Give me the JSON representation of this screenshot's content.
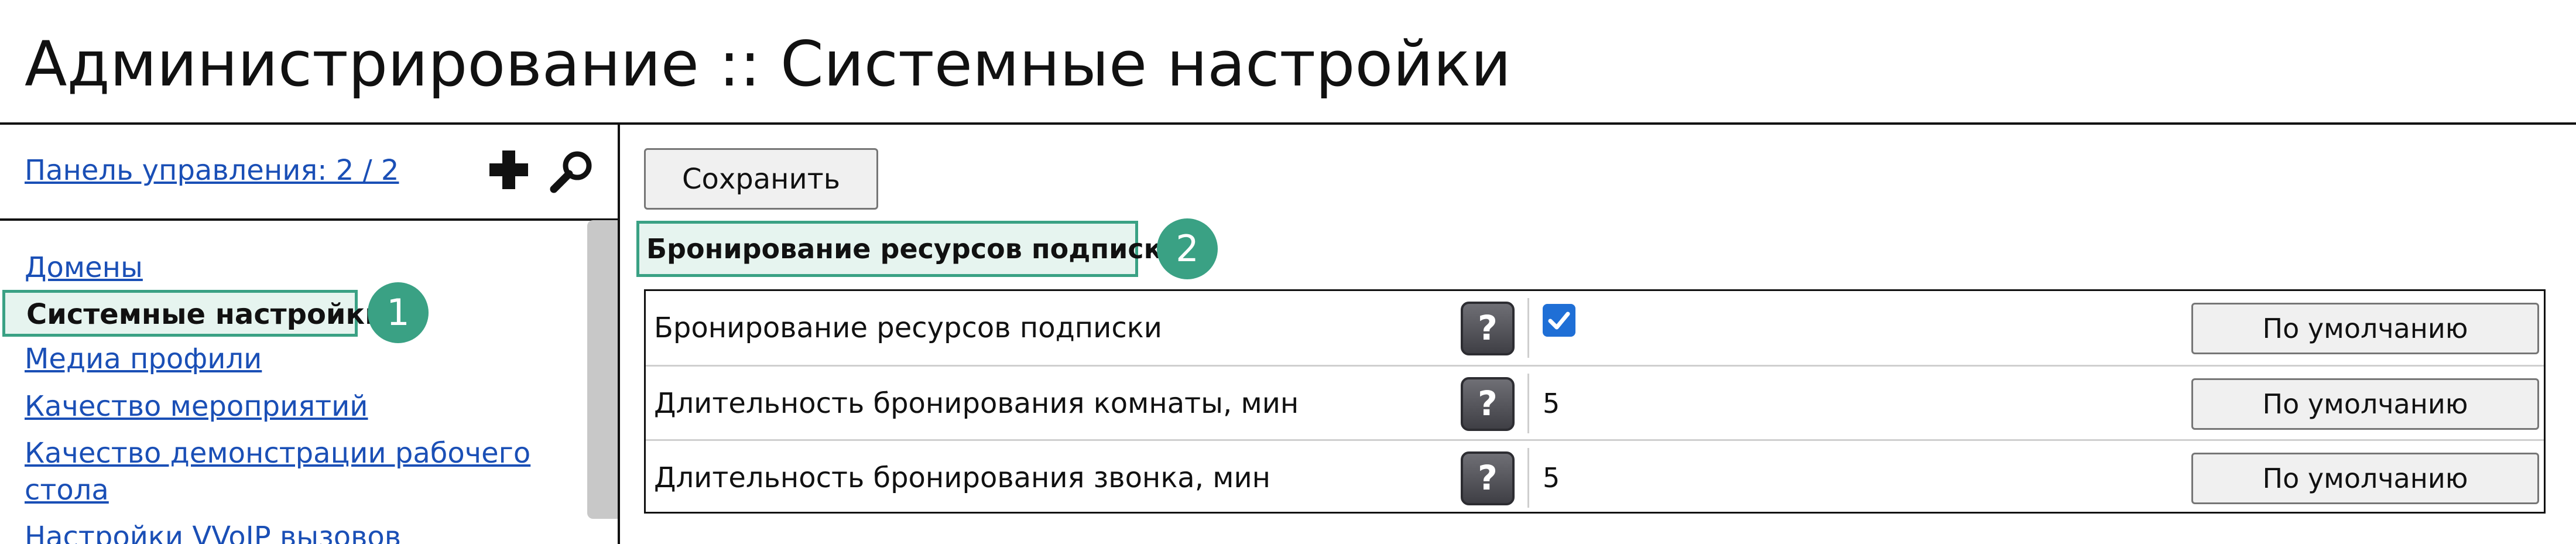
{
  "page": {
    "title": "Администрирование :: Системные настройки"
  },
  "sidebar": {
    "panel_link": "Панель управления: 2 / 2",
    "add_icon": "plus-icon",
    "search_icon": "magnifier-icon",
    "items": [
      {
        "label": "Домены",
        "active": false
      },
      {
        "label": "Системные настройки",
        "active": true
      },
      {
        "label": "Медиа профили",
        "active": false
      },
      {
        "label": "Качество мероприятий",
        "active": false
      },
      {
        "label_line1": "Качество демонстрации рабочего",
        "label_line2": "стола",
        "active": false
      },
      {
        "label": "Настройки VVoIP вызовов",
        "active": false
      }
    ]
  },
  "callouts": {
    "one": "1",
    "two": "2"
  },
  "main": {
    "save_label": "Сохранить",
    "section_title": "Бронирование ресурсов подписки",
    "rows": [
      {
        "label": "Бронирование ресурсов подписки",
        "help": "?",
        "value_type": "checkbox",
        "checked": true,
        "default_label": "По умолчанию"
      },
      {
        "label": "Длительность бронирования комнаты, мин",
        "help": "?",
        "value": "5",
        "default_label": "По умолчанию"
      },
      {
        "label": "Длительность бронирования звонка, мин",
        "help": "?",
        "value": "5",
        "default_label": "По умолчанию"
      }
    ]
  },
  "colors": {
    "accent": "#3aa184",
    "accent_bg": "#e6f4ef",
    "link": "#1a4fb6",
    "checkbox": "#1f6fd6"
  }
}
